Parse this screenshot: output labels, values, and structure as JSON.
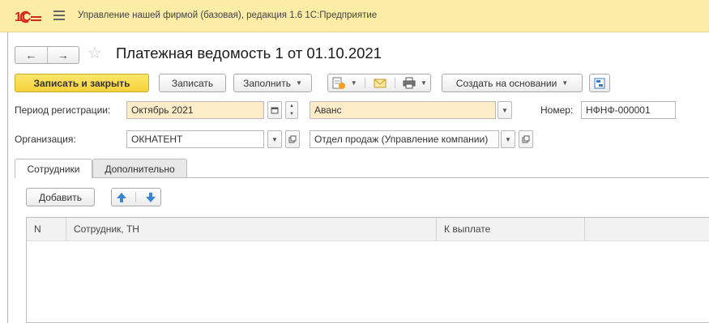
{
  "app": {
    "title": "Управление нашей фирмой (базовая), редакция 1.6 1С:Предприятие",
    "logo_text": "1С"
  },
  "nav": {
    "back": "←",
    "forward": "→",
    "favorite": "☆"
  },
  "document": {
    "title": "Платежная ведомость 1 от 01.10.2021"
  },
  "toolbar": {
    "save_close": "Записать и закрыть",
    "save": "Записать",
    "fill": "Заполнить",
    "create_based": "Создать на основании"
  },
  "form": {
    "period_label": "Период регистрации:",
    "period_value": "Октябрь 2021",
    "type_value": "Аванс",
    "number_label": "Номер:",
    "number_value": "НФНФ-000001",
    "org_label": "Организация:",
    "org_value": "ОКНАТЕНТ",
    "dept_value": "Отдел продаж (Управление компании)"
  },
  "tabs": [
    {
      "label": "Сотрудники",
      "active": true
    },
    {
      "label": "Дополнительно",
      "active": false
    }
  ],
  "table_toolbar": {
    "add": "Добавить"
  },
  "table": {
    "columns": [
      "N",
      "Сотрудник, ТН",
      "К выплате"
    ],
    "rows": []
  },
  "colors": {
    "titlebar_bg": "#fbeca6",
    "primary_button": "#f5d23a",
    "required_field_bg": "#fdecc8",
    "arrow_blue": "#3a86d0"
  }
}
